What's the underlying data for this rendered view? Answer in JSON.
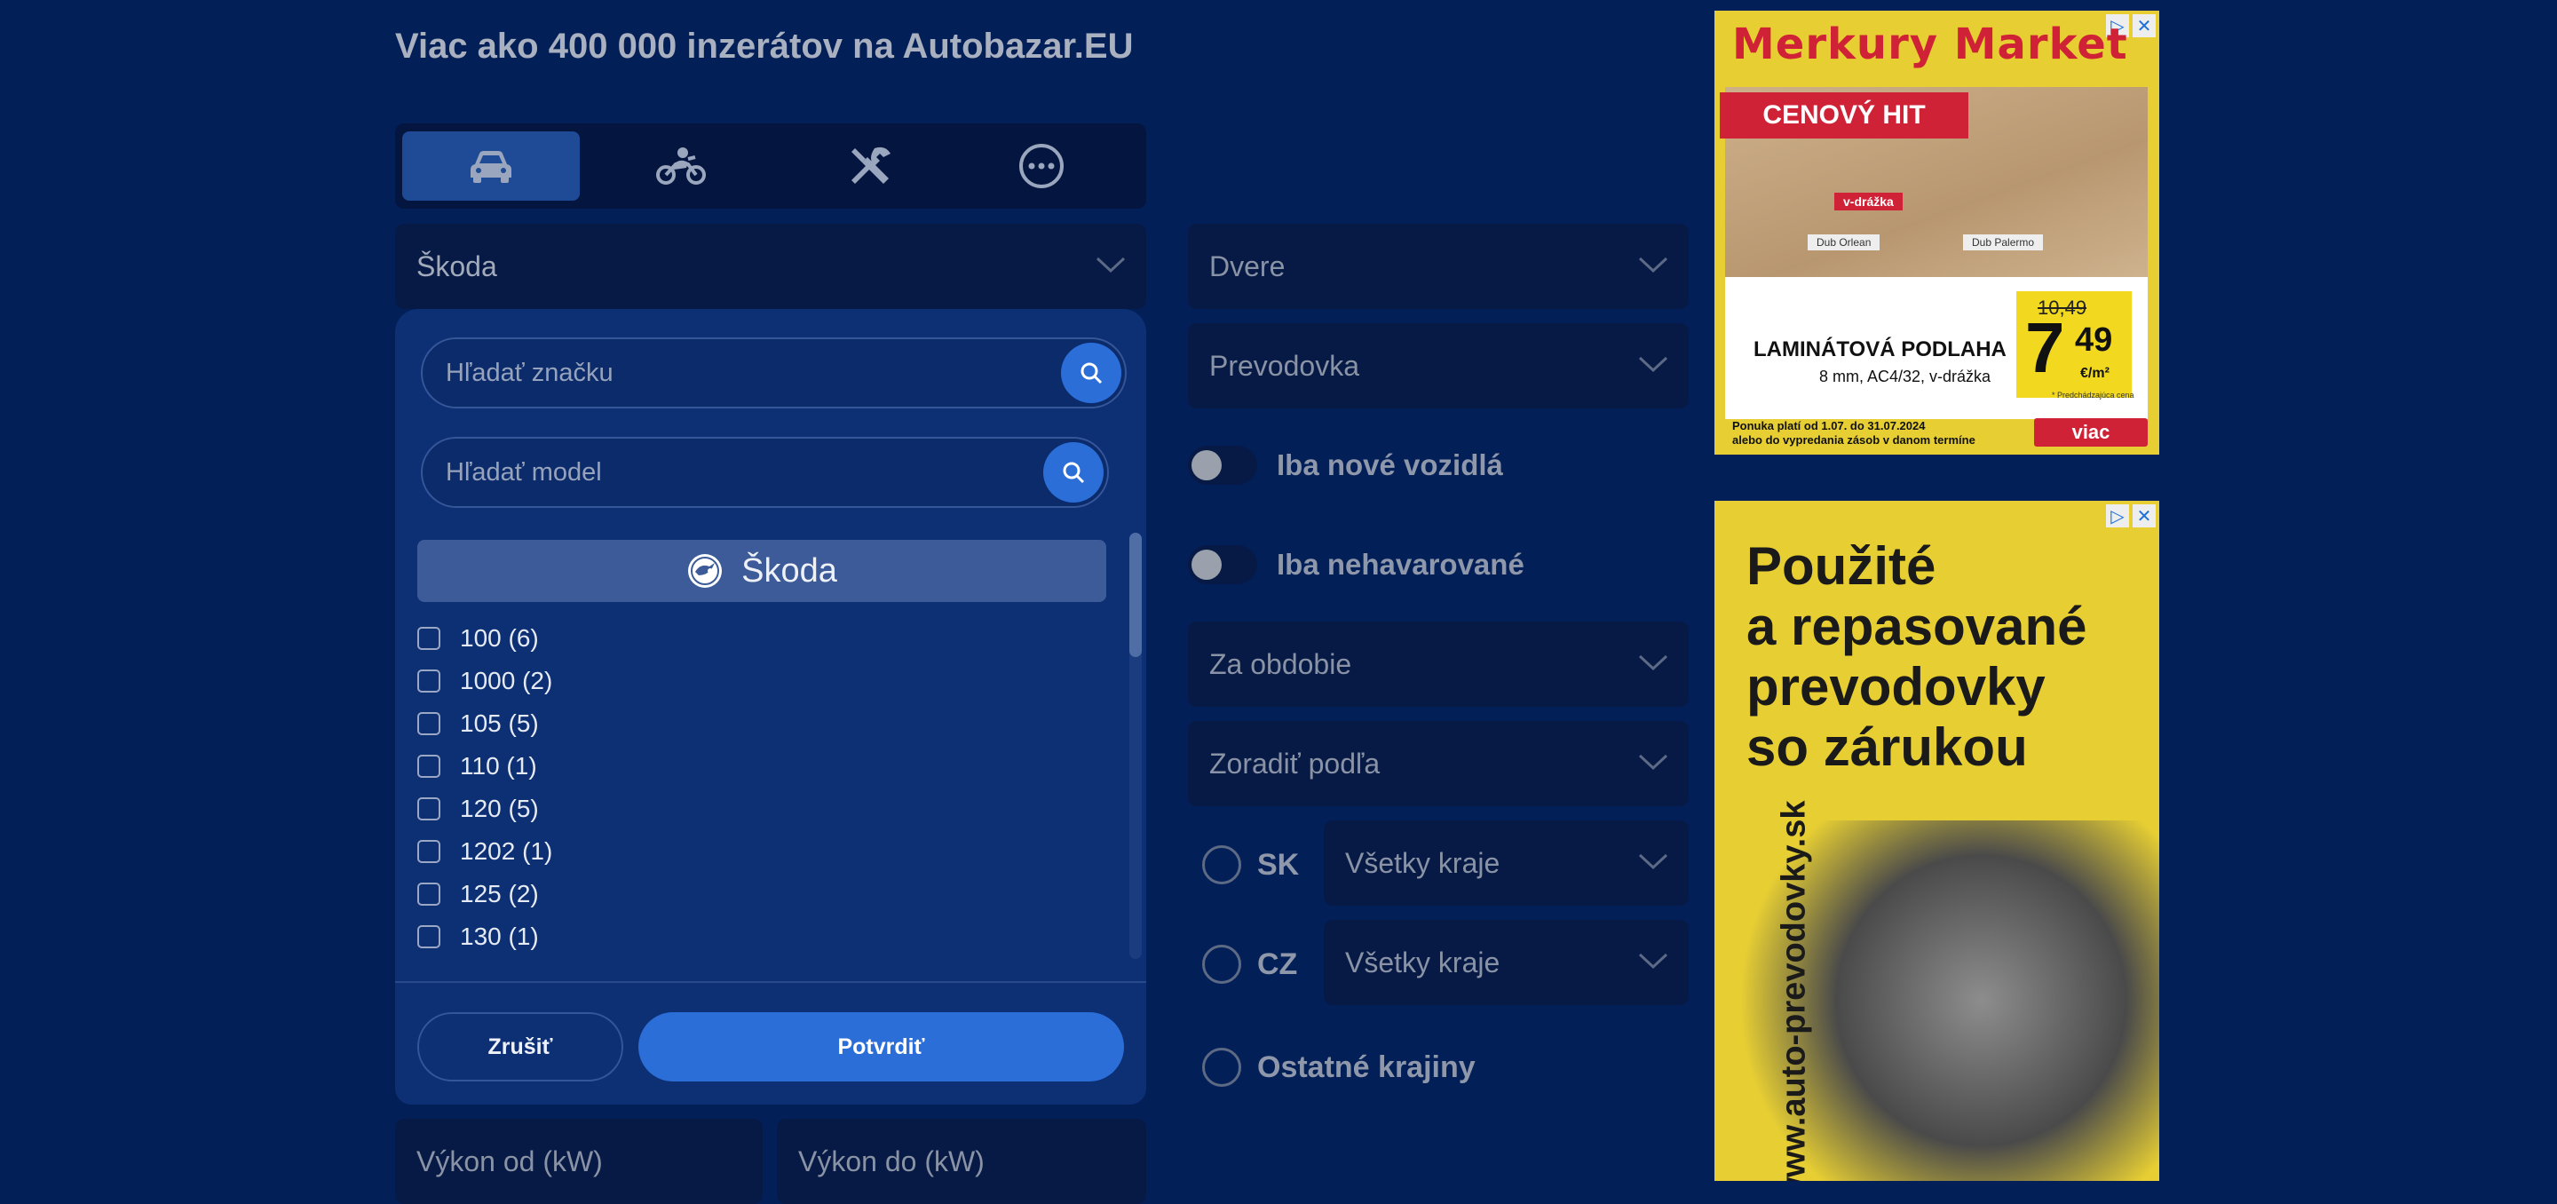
{
  "header": {
    "title": "Viac ako 400 000 inzerátov na Autobazar.EU"
  },
  "tabs": [
    {
      "icon": "car-icon",
      "active": true
    },
    {
      "icon": "motorcycle-icon",
      "active": false
    },
    {
      "icon": "tools-icon",
      "active": false
    },
    {
      "icon": "more-icon",
      "active": false
    }
  ],
  "brand_select": {
    "value": "Škoda"
  },
  "panel": {
    "brand_search_placeholder": "Hľadať značku",
    "model_search_placeholder": "Hľadať model",
    "selected_brand": "Škoda",
    "models": [
      {
        "label": "100 (6)",
        "checked": false
      },
      {
        "label": "1000 (2)",
        "checked": false
      },
      {
        "label": "105 (5)",
        "checked": false
      },
      {
        "label": "110 (1)",
        "checked": false
      },
      {
        "label": "120 (5)",
        "checked": false
      },
      {
        "label": "1202 (1)",
        "checked": false
      },
      {
        "label": "125 (2)",
        "checked": false
      },
      {
        "label": "130 (1)",
        "checked": false
      }
    ],
    "cancel_label": "Zrušiť",
    "confirm_label": "Potvrdiť"
  },
  "power": {
    "from_placeholder": "Výkon od (kW)",
    "to_placeholder": "Výkon do (kW)"
  },
  "filters": {
    "doors": "Dvere",
    "transmission": "Prevodovka",
    "only_new": "Iba nové vozidlá",
    "only_undamaged": "Iba nehavarované",
    "period": "Za obdobie",
    "sort": "Zoradiť podľa"
  },
  "regions": {
    "sk_label": "SK",
    "sk_select": "Všetky kraje",
    "cz_label": "CZ",
    "cz_select": "Všetky kraje",
    "other_label": "Ostatné krajiny"
  },
  "ads": {
    "ad1": {
      "brand": "Merkury Market",
      "badge": "CENOVÝ HIT",
      "product": "LAMINÁTOVÁ PODLAHA",
      "spec": "8 mm, AC4/32, v-drážka",
      "old_price": "10,49",
      "price_main": "7",
      "price_cents": "49",
      "unit": "€/m²",
      "validity_1": "Ponuka platí od 1.07. do 31.07.2024",
      "validity_2": "alebo do vypredania zásob v danom termíne",
      "more": "viac",
      "note": "* Predchádzajúca cena",
      "tag1": "v-drážka",
      "tag2": "Dub Orlean",
      "tag3": "Dub Palermo"
    },
    "ad2": {
      "line1": "Použité",
      "line2": "a repasované",
      "line3": "prevodovky",
      "line4": "so zárukou",
      "url": "www.auto-prevodovky.sk"
    }
  }
}
